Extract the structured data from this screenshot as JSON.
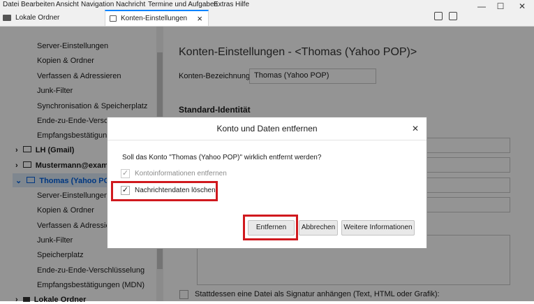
{
  "menu": [
    "Datei",
    "Bearbeiten",
    "Ansicht",
    "Navigation",
    "Nachricht",
    "Termine und Aufgaben",
    "Extras",
    "Hilfe"
  ],
  "window_controls": {
    "minimize": "—",
    "maximize": "☐",
    "close": "✕"
  },
  "tabs": [
    {
      "label": "Lokale Ordner"
    },
    {
      "label": "Konten-Einstellungen",
      "close": "×"
    }
  ],
  "sidebar": {
    "top_items": [
      "Server-Einstellungen",
      "Kopien & Ordner",
      "Verfassen & Adressieren",
      "Junk-Filter",
      "Synchronisation & Speicherplatz",
      "Ende-zu-Ende-Verschlüsselung",
      "Empfangsbestätigungen (MDN)"
    ],
    "accounts": [
      {
        "label": "LH (Gmail)",
        "toggle": "›"
      },
      {
        "label": "Mustermann@example.de",
        "toggle": "›"
      },
      {
        "label": "Thomas (Yahoo POP)",
        "toggle": "⌄"
      }
    ],
    "sub_items": [
      "Server-Einstellungen",
      "Kopien & Ordner",
      "Verfassen & Adressieren",
      "Junk-Filter",
      "Speicherplatz",
      "Ende-zu-Ende-Verschlüsselung",
      "Empfangsbestätigungen (MDN)"
    ],
    "bottom_account": {
      "label": "Lokale Ordner",
      "toggle": "›"
    }
  },
  "main": {
    "title": "Konten-Einstellungen - <Thomas (Yahoo POP)>",
    "account_name_label": "Konten-Bezeichnung:",
    "account_name_value": "Thomas (Yahoo POP)",
    "section_title": "Standard-Identität",
    "signature_file_label": "Stattdessen eine Datei als Signatur anhängen (Text, HTML oder Grafik):"
  },
  "dialog": {
    "title": "Konto und Daten entfernen",
    "close": "✕",
    "question": "Soll das Konto \"Thomas (Yahoo POP)\" wirklich entfernt werden?",
    "checkbox_account_info": {
      "label": "Kontoinformationen entfernen",
      "checked": true,
      "disabled": true,
      "mark": "✓"
    },
    "checkbox_message_data": {
      "label": "Nachrichtendaten löschen",
      "checked": true,
      "disabled": false,
      "mark": "✓"
    },
    "buttons": {
      "remove": "Entfernen",
      "cancel": "Abbrechen",
      "more_info": "Weitere Informationen"
    }
  },
  "colors": {
    "highlight": "#d0191e",
    "accent": "#0a84ff",
    "selected_account_text": "#0060df"
  }
}
